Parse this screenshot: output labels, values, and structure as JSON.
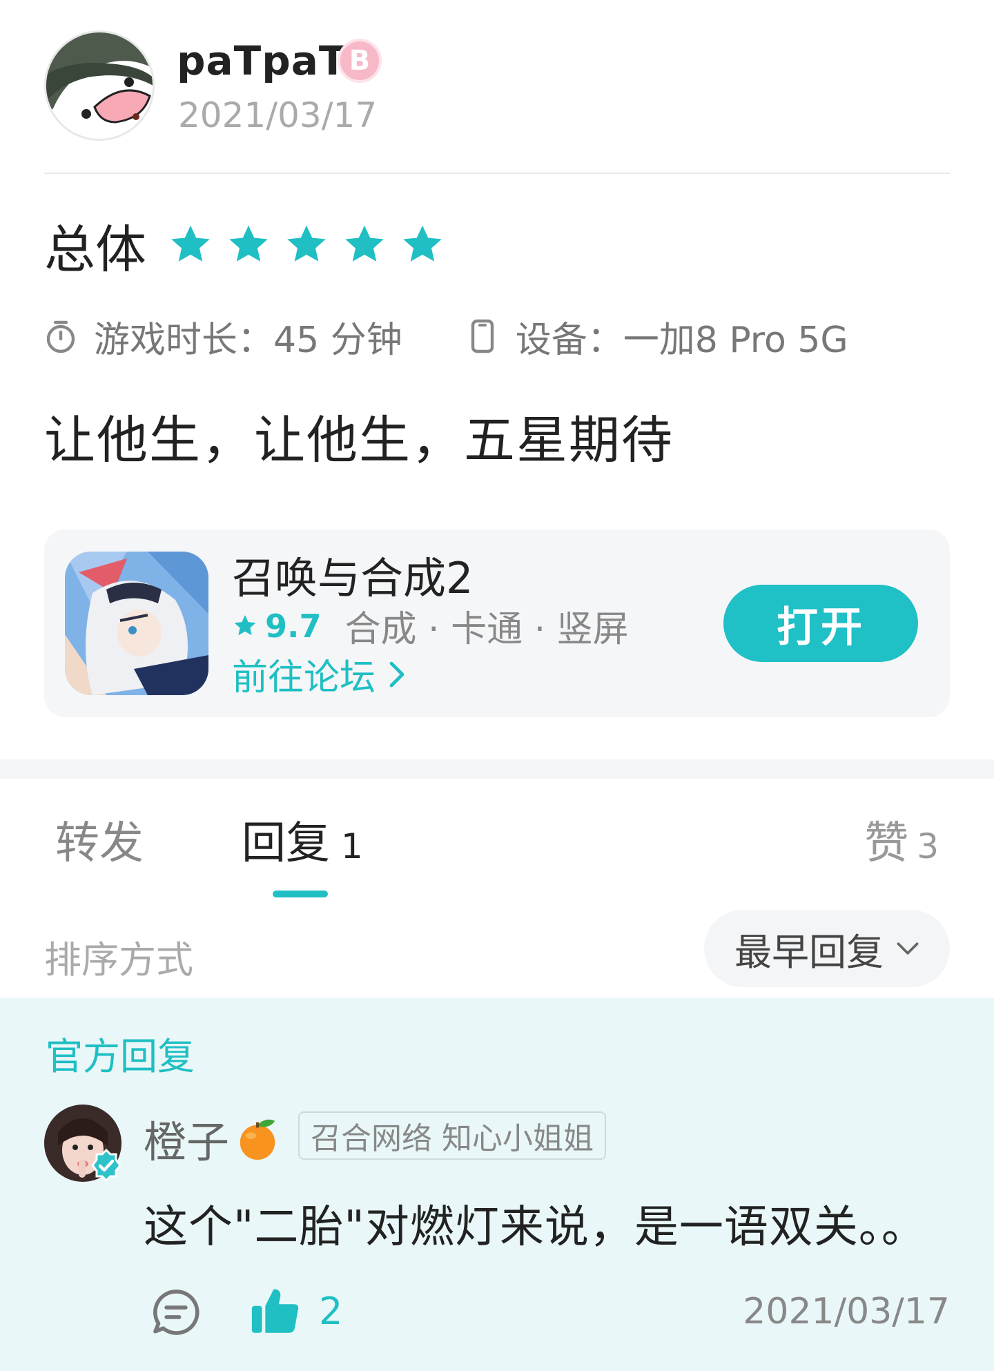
{
  "author": {
    "username": "paTpaT",
    "badge": "B",
    "date": "2021/03/17"
  },
  "rating": {
    "label": "总体",
    "stars": 5,
    "max_stars": 5
  },
  "meta": {
    "playtime": "游戏时长：45 分钟",
    "device": "设备：一加8 Pro 5G"
  },
  "review": {
    "text": "让他生，让他生，五星期待"
  },
  "game": {
    "title": "召唤与合成2",
    "score": "9.7",
    "tags": "合成 · 卡通 · 竖屏",
    "forum_link": "前往论坛",
    "open_label": "打开"
  },
  "tabs": {
    "forward": "转发",
    "reply": "回复",
    "reply_count": "1",
    "like": "赞",
    "like_count": "3"
  },
  "sort": {
    "label": "排序方式",
    "selected": "最早回复"
  },
  "official_reply": {
    "section_label": "官方回复",
    "name": "橙子",
    "role": "召合网络 知心小姐姐",
    "text": "这个\"二胎\"对燃灯来说，是一语双关。。",
    "like_count": "2",
    "date": "2021/03/17"
  },
  "colors": {
    "accent": "#1fbfc3",
    "official_bg": "#e9f7f8"
  },
  "icons": [
    "timer-icon",
    "phone-icon",
    "star-icon",
    "chevron-right-icon",
    "chevron-down-icon",
    "verified-icon",
    "orange-emoji-icon",
    "comment-icon",
    "thumbs-up-icon"
  ]
}
